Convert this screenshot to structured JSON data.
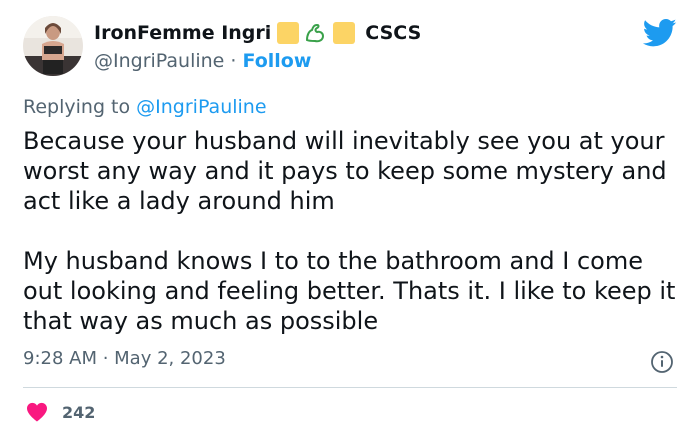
{
  "author": {
    "display_name": "IronFemme Ingri",
    "name_suffix": "CSCS",
    "handle": "@IngriPauline",
    "separator": "·",
    "follow_label": "Follow",
    "name_emojis": [
      "yellow-square",
      "flexed-biceps",
      "yellow-square"
    ]
  },
  "reply": {
    "prefix": "Replying to",
    "mention": "@IngriPauline"
  },
  "tweet": {
    "paragraph_1": "Because your husband will inevitably see you at your worst any way and it pays to keep some mystery and act like a lady around him",
    "paragraph_2": "My husband knows I to to the bathroom and I come out looking and feeling better. Thats it. I like to keep it that way as much as possible",
    "timestamp": "9:28 AM · May 2, 2023"
  },
  "engagement": {
    "likes": "242"
  },
  "icons": {
    "platform": "twitter-bird-icon",
    "info": "info-icon",
    "like": "heart-icon"
  },
  "colors": {
    "brand_blue": "#1d9bf0",
    "like_pink": "#f91880",
    "secondary_text": "#536471",
    "primary_text": "#0f1419",
    "emoji_yellow": "#fcd465"
  }
}
